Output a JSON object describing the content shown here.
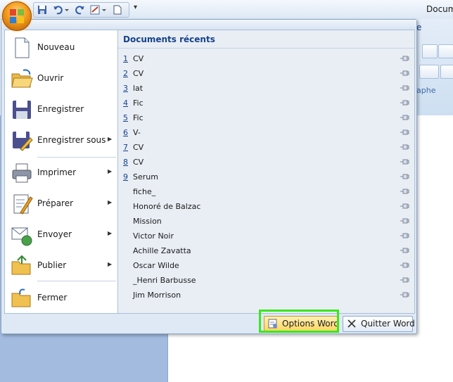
{
  "window": {
    "title": "Docum"
  },
  "ribbon": {
    "tab_partial": "e",
    "group_label_partial": "aphe"
  },
  "menu": {
    "commands": [
      {
        "label": "Nouveau",
        "icon": "new-document-icon",
        "has_submenu": false
      },
      {
        "label": "Ouvrir",
        "icon": "open-folder-icon",
        "has_submenu": false
      },
      {
        "label": "Enregistrer",
        "icon": "save-icon",
        "has_submenu": false
      },
      {
        "label": "Enregistrer sous",
        "icon": "save-as-icon",
        "has_submenu": true
      },
      {
        "label": "Imprimer",
        "icon": "printer-icon",
        "has_submenu": true
      },
      {
        "label": "Préparer",
        "icon": "prepare-icon",
        "has_submenu": true
      },
      {
        "label": "Envoyer",
        "icon": "send-icon",
        "has_submenu": true
      },
      {
        "label": "Publier",
        "icon": "publish-icon",
        "has_submenu": true
      },
      {
        "label": "Fermer",
        "icon": "close-folder-icon",
        "has_submenu": false
      }
    ],
    "recent": {
      "header": "Documents récents",
      "items": [
        {
          "num": "1",
          "name": "CV"
        },
        {
          "num": "2",
          "name": "CV"
        },
        {
          "num": "3",
          "name": "lat"
        },
        {
          "num": "4",
          "name": "Fic"
        },
        {
          "num": "5",
          "name": "Fic"
        },
        {
          "num": "6",
          "name": "V-"
        },
        {
          "num": "7",
          "name": "CV"
        },
        {
          "num": "8",
          "name": "CV"
        },
        {
          "num": "9",
          "name": "Serum"
        },
        {
          "num": "",
          "name": "fiche_"
        },
        {
          "num": "",
          "name": "Honoré de Balzac"
        },
        {
          "num": "",
          "name": "Mission"
        },
        {
          "num": "",
          "name": "Victor Noir"
        },
        {
          "num": "",
          "name": "Achille Zavatta"
        },
        {
          "num": "",
          "name": "Oscar Wilde"
        },
        {
          "num": "",
          "name": "_Henri Barbusse"
        },
        {
          "num": "",
          "name": "Jim Morrison"
        }
      ]
    },
    "buttons": {
      "options": "Options Word",
      "quit": "Quitter Word"
    }
  },
  "colors": {
    "accent": "#15428b",
    "highlight": "#39e81b",
    "orb": "#f39b1c"
  }
}
